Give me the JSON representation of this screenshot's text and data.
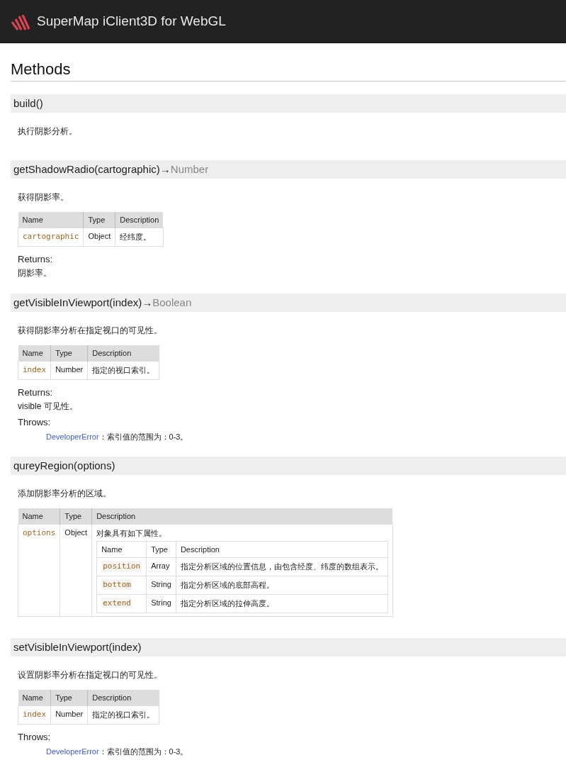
{
  "header": {
    "title": "SuperMap iClient3D for WebGL"
  },
  "section_title": "Methods",
  "methods": [
    {
      "name": "build()",
      "description": "执行阴影分析。"
    },
    {
      "name": "getShadowRadio(cartographic)",
      "arrow": "→",
      "returns_type": "Number",
      "description": "获得阴影率。",
      "params": {
        "columns": [
          "Name",
          "Type",
          "Description"
        ],
        "rows": [
          {
            "name": "cartographic",
            "type": "Object",
            "description": "经纬度。"
          }
        ]
      },
      "returns_label": "Returns:",
      "returns": "阴影率。"
    },
    {
      "name": "getVisibleInViewport(index)",
      "arrow": "→",
      "returns_type": "Boolean",
      "description": "获得阴影率分析在指定视口的可见性。",
      "params": {
        "columns": [
          "Name",
          "Type",
          "Description"
        ],
        "rows": [
          {
            "name": "index",
            "type": "Number",
            "description": "指定的视口索引。"
          }
        ]
      },
      "returns_label": "Returns:",
      "returns": "visible 可见性。",
      "throws_label": "Throws:",
      "throws_error": "DeveloperError",
      "throws_text": "：索引值的范围为：0-3。"
    },
    {
      "name": "qureyRegion(options)",
      "description": "添加阴影率分析的区域。",
      "params": {
        "columns": [
          "Name",
          "Type",
          "Description"
        ],
        "rows": [
          {
            "name": "options",
            "type": "Object",
            "description": "对象具有如下属性。",
            "properties": {
              "columns": [
                "Name",
                "Type",
                "Description"
              ],
              "rows": [
                {
                  "name": "position",
                  "type": "Array",
                  "description": "指定分析区域的位置信息，由包含经度、纬度的数组表示。"
                },
                {
                  "name": "bottom",
                  "type": "String",
                  "description": "指定分析区域的底部高程。"
                },
                {
                  "name": "extend",
                  "type": "String",
                  "description": "指定分析区域的拉伸高度。"
                }
              ]
            }
          }
        ]
      }
    },
    {
      "name": "setVisibleInViewport(index)",
      "description": "设置阴影率分析在指定视口的可见性。",
      "params": {
        "columns": [
          "Name",
          "Type",
          "Description"
        ],
        "rows": [
          {
            "name": "index",
            "type": "Number",
            "description": "指定的视口索引。"
          }
        ]
      },
      "throws_label": "Throws:",
      "throws_error": "DeveloperError",
      "throws_text": "：索引值的范围为：0-3。"
    }
  ]
}
